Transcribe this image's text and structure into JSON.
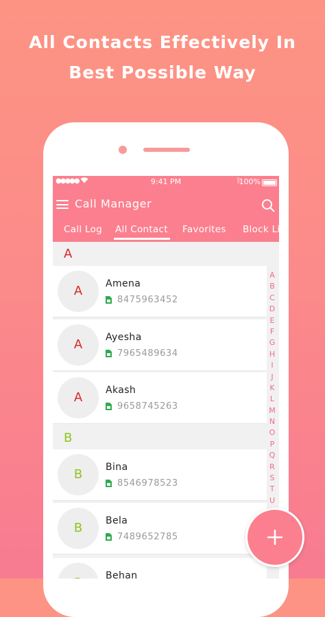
{
  "headline": {
    "line1": "All Contacts Effectively In",
    "line2": "Best Possible Way"
  },
  "status_bar": {
    "signal": "●●●●●",
    "time": "9:41 PM",
    "battery": "100%"
  },
  "app": {
    "title": "Call Manager",
    "tabs": [
      "Call Log",
      "All Contact",
      "Favorites",
      "Block Li"
    ],
    "active_tab": "All Contact"
  },
  "sections": [
    {
      "letter": "A",
      "color": "#d62828",
      "contacts": [
        {
          "initial": "A",
          "name": "Amena",
          "number": "8475963452"
        },
        {
          "initial": "A",
          "name": "Ayesha",
          "number": "7965489634"
        },
        {
          "initial": "A",
          "name": "Akash",
          "number": "9658745263"
        }
      ]
    },
    {
      "letter": "B",
      "color": "#8fc320",
      "contacts": [
        {
          "initial": "B",
          "name": "Bina",
          "number": "8546978523"
        },
        {
          "initial": "B",
          "name": "Bela",
          "number": "7489652785"
        },
        {
          "initial": "B",
          "name": "Behan",
          "number": ""
        }
      ]
    }
  ],
  "alphabet_index": [
    "A",
    "B",
    "C",
    "D",
    "E",
    "F",
    "G",
    "H",
    "I",
    "J",
    "K",
    "L",
    "M",
    "N",
    "O",
    "P",
    "Q",
    "R",
    "S",
    "T",
    "U"
  ],
  "colors": {
    "accent": "#fb7f8e",
    "sim_icon": "#2eaa4f",
    "index_letters": "#f06b84"
  },
  "icons": {
    "menu": "hamburger-icon",
    "search": "search-icon",
    "sim": "sim-card-icon",
    "fab": "plus-icon"
  }
}
